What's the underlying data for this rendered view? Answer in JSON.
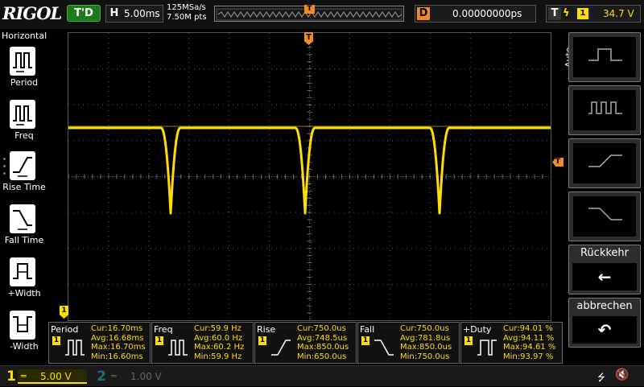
{
  "header": {
    "brand": "RIGOL",
    "run_status": "T'D",
    "timebase_tag": "H",
    "timebase": "5.00ms",
    "sample_rate": "125MSa/s",
    "memory_depth": "7.50M pts",
    "trigger_pos_marker": "T",
    "delay_tag": "D",
    "delay": "0.00000000ps",
    "trigger_tag": "T",
    "trigger_edge": "ϟ",
    "trigger_source": "1",
    "trigger_level": "34.7 V"
  },
  "sidebar": {
    "title": "Horizontal",
    "items": [
      {
        "label": "Period",
        "icon": "period-icon"
      },
      {
        "label": "Freq",
        "icon": "freq-icon"
      },
      {
        "label": "Rise Time",
        "icon": "rise-time-icon"
      },
      {
        "label": "Fall Time",
        "icon": "fall-time-icon"
      },
      {
        "label": "+Width",
        "icon": "pos-width-icon"
      },
      {
        "label": "-Width",
        "icon": "neg-width-icon"
      }
    ]
  },
  "screen": {
    "trigger_marker": "T",
    "trigger_level_marker": "T",
    "ch1_marker": "1",
    "trace_color": "#ffdd00"
  },
  "measurements": [
    {
      "name": "Period",
      "ch": "1",
      "cur": "Cur:16.70ms",
      "avg": "Avg:16.68ms",
      "max": "Max:16.70ms",
      "min": "Min:16.60ms"
    },
    {
      "name": "Freq",
      "ch": "1",
      "cur": "Cur:59.9 Hz",
      "avg": "Avg:60.0 Hz",
      "max": "Max:60.2 Hz",
      "min": "Min:59.9 Hz"
    },
    {
      "name": "Rise",
      "ch": "1",
      "cur": "Cur:750.0us",
      "avg": "Avg:748.5us",
      "max": "Max:850.0us",
      "min": "Min:650.0us"
    },
    {
      "name": "Fall",
      "ch": "1",
      "cur": "Cur:750.0us",
      "avg": "Avg:781.8us",
      "max": "Max:850.0us",
      "min": "Min:750.0us"
    },
    {
      "name": "+Duty",
      "ch": "1",
      "cur": "Cur:94.01 %",
      "avg": "Avg:94.11 %",
      "max": "Max:94.61 %",
      "min": "Min:93.97 %"
    }
  ],
  "rightmenu": {
    "mode": "Auto",
    "back_label": "Rückkehr",
    "back_icon": "←",
    "cancel_label": "abbrechen",
    "cancel_icon": "↶"
  },
  "bottom": {
    "ch1_num": "1",
    "ch1_coupling": "═",
    "ch1_scale": "5.00 V",
    "ch2_num": "2",
    "ch2_coupling": "═",
    "ch2_scale": "1.00 V",
    "usb_icon": "⭍",
    "speaker_icon": "🔇"
  }
}
